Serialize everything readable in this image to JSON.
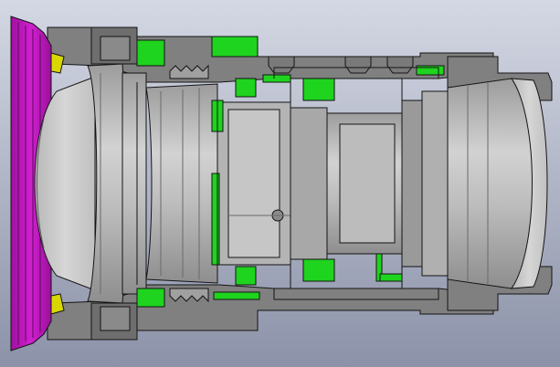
{
  "viewport": {
    "background_top": "#d4d8e4",
    "background_bottom": "#8c92a8"
  },
  "colors": {
    "housing_gray": "#808080",
    "housing_dark": "#6e6e6e",
    "lens_light": "#c8c8c8",
    "lens_mid": "#a6a6a6",
    "spacer_green": "#1ed41e",
    "front_ring_magenta": "#c814c8",
    "front_ring_dark": "#8a1a8a",
    "seal_yellow": "#d8d800",
    "edge_black": "#141414"
  },
  "components": [
    "front-magenta-ring",
    "front-dome-lens",
    "lens-group-1",
    "lens-group-2",
    "inner-barrel",
    "green-spacers",
    "focus-threads",
    "rear-element",
    "outer-housing"
  ]
}
